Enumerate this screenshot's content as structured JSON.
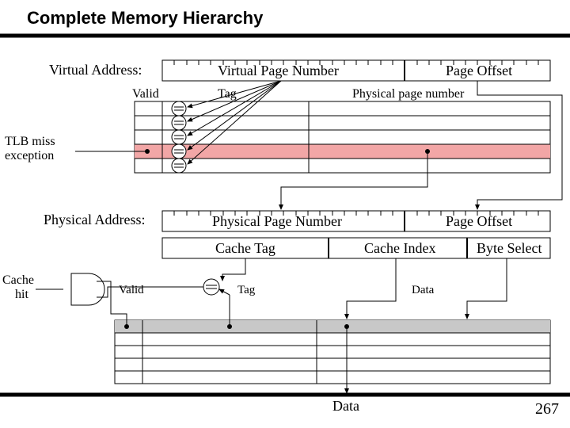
{
  "title": "Complete Memory Hierarchy",
  "page_number": "267",
  "va_label": "Virtual Address:",
  "pa_label": "Physical Address:",
  "va_vpn": "Virtual Page Number",
  "va_off": "Page Offset",
  "pa_ppn": "Physical Page Number",
  "pa_off": "Page Offset",
  "tlb_valid": "Valid",
  "tlb_tag": "Tag",
  "tlb_ppn": "Physical page number",
  "tlb_miss": "TLB miss",
  "tlb_exc": "exception",
  "cache_tag_hdr": "Cache Tag",
  "cache_idx_hdr": "Cache Index",
  "cache_bs_hdr": "Byte Select",
  "cache_hit": "Cache hit",
  "cache_valid": "Valid",
  "cache_tag": "Tag",
  "cache_data": "Data",
  "data_out": "Data",
  "chart_data": {
    "type": "flow-diagram",
    "title": "Complete Memory Hierarchy",
    "virtual_address": {
      "fields": [
        "Virtual Page Number",
        "Page Offset"
      ],
      "bits": 32
    },
    "tlb": {
      "columns": [
        "Valid",
        "Tag",
        "Physical page number"
      ],
      "rows": 5,
      "highlight_row": 3,
      "miss_signal": "TLB miss exception"
    },
    "physical_address": {
      "fields": [
        "Physical Page Number",
        "Page Offset"
      ],
      "bits": 32,
      "decoded_as": [
        "Cache Tag",
        "Cache Index",
        "Byte Select"
      ]
    },
    "cache": {
      "columns": [
        "Valid",
        "Tag",
        "Data"
      ],
      "rows": 5,
      "highlight_row": 0,
      "hit_signal": "Cache hit"
    },
    "outputs": [
      "Data"
    ]
  }
}
